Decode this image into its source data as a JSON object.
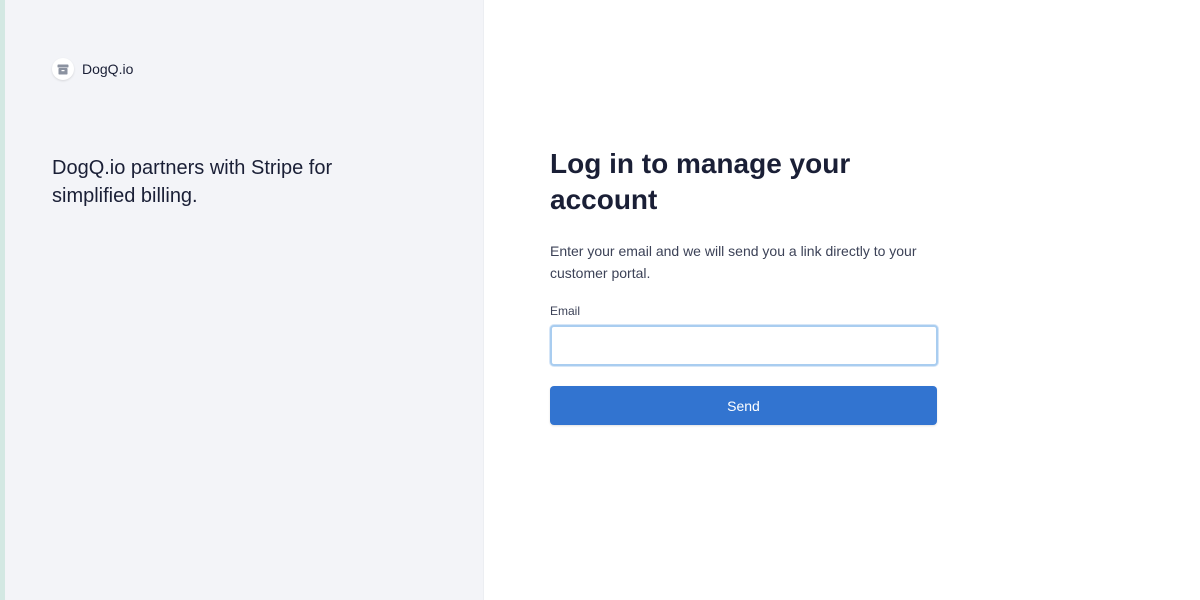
{
  "brand": {
    "name": "DogQ.io",
    "logo_icon": "store-icon"
  },
  "left_panel": {
    "tagline": "DogQ.io partners with Stripe for simplified billing."
  },
  "login": {
    "title": "Log in to manage your account",
    "description": "Enter your email and we will send you a link directly to your customer portal.",
    "email_label": "Email",
    "email_value": "",
    "email_placeholder": "",
    "send_label": "Send"
  },
  "colors": {
    "left_panel_bg": "#f3f4f8",
    "edge_strip": "#d3e8e3",
    "primary_button": "#3274d0",
    "input_focus_border": "#a9cdf0",
    "text_primary": "#1a1f36"
  }
}
